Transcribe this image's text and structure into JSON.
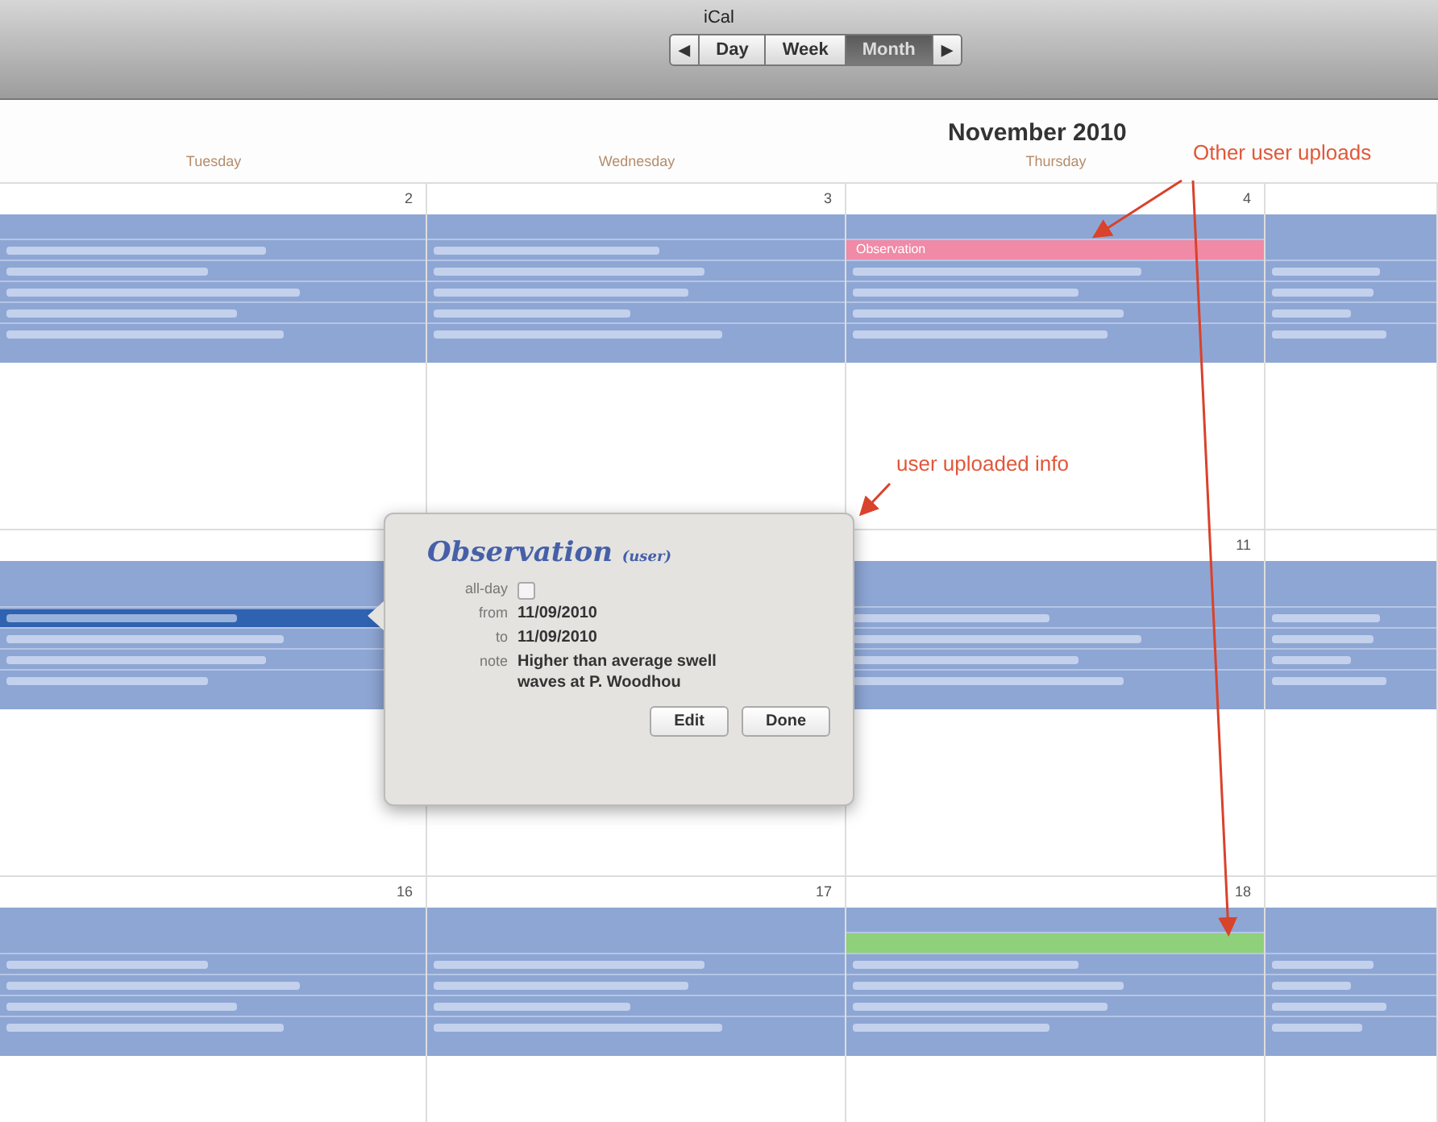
{
  "window": {
    "title": "iCal"
  },
  "view_switcher": {
    "prev": "◀",
    "next": "▶",
    "views": [
      {
        "label": "Day",
        "selected": false
      },
      {
        "label": "Week",
        "selected": false
      },
      {
        "label": "Month",
        "selected": true
      }
    ]
  },
  "month_title": "November 2010",
  "weekdays": [
    "Tuesday",
    "Wednesday",
    "Thursday"
  ],
  "weeks": [
    {
      "days": [
        {
          "number": "2",
          "events": [
            {
              "kind": "event"
            },
            {
              "kind": "event"
            },
            {
              "kind": "event"
            },
            {
              "kind": "event"
            },
            {
              "kind": "event"
            }
          ]
        },
        {
          "number": "3",
          "events": [
            {
              "kind": "event"
            },
            {
              "kind": "event"
            },
            {
              "kind": "event"
            },
            {
              "kind": "event"
            },
            {
              "kind": "event"
            }
          ]
        },
        {
          "number": "4",
          "events": [
            {
              "kind": "highlight",
              "color": "#f08aa6",
              "label": "Observation"
            },
            {
              "kind": "event"
            },
            {
              "kind": "event"
            },
            {
              "kind": "event"
            },
            {
              "kind": "event"
            }
          ]
        },
        {
          "events": [
            {
              "kind": "event"
            },
            {
              "kind": "event"
            },
            {
              "kind": "event"
            },
            {
              "kind": "event"
            }
          ]
        }
      ]
    },
    {
      "days": [
        {
          "events": [
            {
              "kind": "selected"
            },
            {
              "kind": "event"
            },
            {
              "kind": "event"
            },
            {
              "kind": "event"
            }
          ]
        },
        {
          "number": "11",
          "events": [
            {
              "kind": "event"
            },
            {
              "kind": "event"
            },
            {
              "kind": "event"
            },
            {
              "kind": "event"
            }
          ]
        },
        {
          "events": [
            {
              "kind": "event"
            },
            {
              "kind": "event"
            },
            {
              "kind": "event"
            },
            {
              "kind": "event"
            }
          ]
        }
      ]
    },
    {
      "days": [
        {
          "number": "16",
          "events": [
            {
              "kind": "event"
            },
            {
              "kind": "event"
            },
            {
              "kind": "event"
            },
            {
              "kind": "event"
            }
          ]
        },
        {
          "number": "17",
          "events": [
            {
              "kind": "event"
            },
            {
              "kind": "event"
            },
            {
              "kind": "event"
            },
            {
              "kind": "event"
            }
          ]
        },
        {
          "number": "18",
          "events": [
            {
              "kind": "highlight",
              "color": "#8fd07a"
            },
            {
              "kind": "event"
            },
            {
              "kind": "event"
            },
            {
              "kind": "event"
            },
            {
              "kind": "event"
            }
          ]
        },
        {
          "events": [
            {
              "kind": "event"
            },
            {
              "kind": "event"
            },
            {
              "kind": "event"
            },
            {
              "kind": "event"
            }
          ]
        }
      ]
    }
  ],
  "popover": {
    "title": "Observation",
    "subtitle": "(user)",
    "all_day": {
      "label": "all-day",
      "checked": false
    },
    "fields": [
      {
        "label": "from",
        "value": "11/09/2010"
      },
      {
        "label": "to",
        "value": "11/09/2010"
      },
      {
        "label": "note",
        "value": "Higher than average swell waves at P. Woodhou"
      }
    ],
    "buttons": [
      "Edit",
      "Done"
    ]
  },
  "annotations": [
    {
      "text": "Other user uploads"
    },
    {
      "text": "user uploaded info"
    }
  ]
}
